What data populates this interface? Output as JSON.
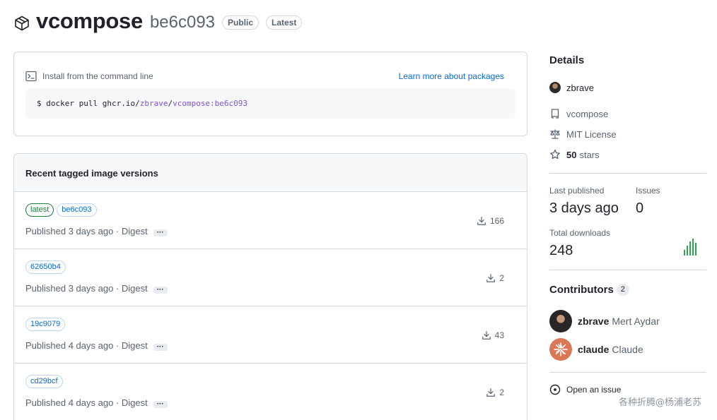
{
  "header": {
    "package_name": "vcompose",
    "version": "be6c093",
    "badges": [
      "Public",
      "Latest"
    ]
  },
  "install": {
    "title": "Install from the command line",
    "learn_more": "Learn more about packages",
    "cmd_prefix": "$ docker pull ghcr.io/",
    "cmd_owner": "zbrave",
    "cmd_sep": "/",
    "cmd_image": "vcompose:be6c093"
  },
  "versions": {
    "heading": "Recent tagged image versions",
    "rows": [
      {
        "tags": [
          "latest",
          "be6c093"
        ],
        "published": "Published 3 days ago · Digest",
        "more": "···",
        "downloads": "166"
      },
      {
        "tags": [
          "62650b4"
        ],
        "published": "Published 3 days ago · Digest",
        "more": "···",
        "downloads": "2"
      },
      {
        "tags": [
          "19c9079"
        ],
        "published": "Published 4 days ago · Digest",
        "more": "···",
        "downloads": "43"
      },
      {
        "tags": [
          "cd29bcf"
        ],
        "published": "Published 4 days ago · Digest",
        "more": "···",
        "downloads": "2"
      }
    ]
  },
  "details": {
    "title": "Details",
    "owner": "zbrave",
    "repo": "vcompose",
    "license": "MIT License",
    "stars_count": "50",
    "stars_label": "stars"
  },
  "stats": {
    "last_published_label": "Last published",
    "last_published_value": "3 days ago",
    "issues_label": "Issues",
    "issues_value": "0",
    "downloads_label": "Total downloads",
    "downloads_value": "248"
  },
  "contributors": {
    "title": "Contributors",
    "count": "2",
    "people": [
      {
        "login": "zbrave",
        "name": "Mert Aydar"
      },
      {
        "login": "claude",
        "name": "Claude"
      }
    ]
  },
  "open_issue": "Open an issue",
  "watermark": "各种折腾@杨浦老苏",
  "colors": {
    "link": "#0969da",
    "purple": "#8250df",
    "green": "#1a7f37",
    "border": "#d1d9e0"
  }
}
